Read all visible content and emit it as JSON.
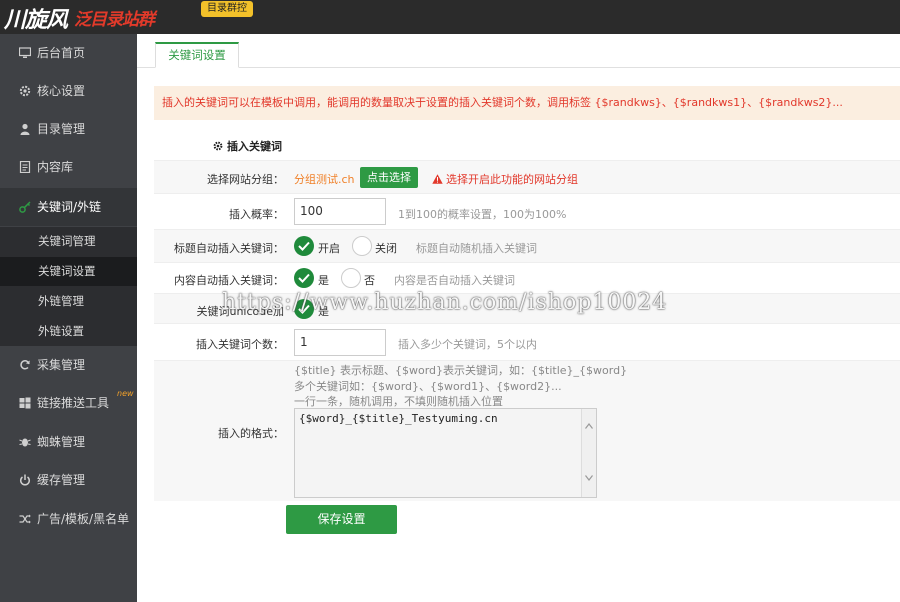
{
  "brand": {
    "logo": "川旋风",
    "subtitle": "泛目录站群",
    "badge": "目录群控"
  },
  "sidebar": {
    "items": [
      {
        "label": "后台首页",
        "icon": "monitor-icon"
      },
      {
        "label": "核心设置",
        "icon": "gear-icon"
      },
      {
        "label": "目录管理",
        "icon": "user-icon"
      },
      {
        "label": "内容库",
        "icon": "document-icon"
      },
      {
        "label": "关键词/外链",
        "icon": "key-icon"
      },
      {
        "label": "采集管理",
        "icon": "refresh-icon"
      },
      {
        "label": "链接推送工具",
        "icon": "windows-icon"
      },
      {
        "label": "蜘蛛管理",
        "icon": "bug-icon"
      },
      {
        "label": "缓存管理",
        "icon": "power-icon"
      },
      {
        "label": "广告/模板/黑名单",
        "icon": "shuffle-icon"
      }
    ],
    "subitems": [
      {
        "label": "关键词管理"
      },
      {
        "label": "关键词设置"
      },
      {
        "label": "外链管理"
      },
      {
        "label": "外链设置"
      }
    ],
    "new_badge": "new"
  },
  "tab": {
    "label": "关键词设置"
  },
  "notice": "插入的关键词可以在模板中调用，能调用的数量取决于设置的插入关键词个数，调用标签 {$randkws}、{$randkws1}、{$randkws2}...",
  "section_title": "插入关键词",
  "form": {
    "site_group": {
      "label": "选择网站分组：",
      "value": "分组测试.ch",
      "button": "点击选择",
      "warning": "选择开启此功能的网站分组"
    },
    "probability": {
      "label": "插入概率：",
      "value": "100",
      "hint": "1到100的概率设置，100为100%"
    },
    "title_auto": {
      "label": "标题自动插入关键词：",
      "on": "开启",
      "off": "关闭",
      "hint": "标题自动随机插入关键词"
    },
    "content_auto": {
      "label": "内容自动插入关键词：",
      "on": "是",
      "off": "否",
      "hint": "内容是否自动插入关键词"
    },
    "unicode": {
      "label": "关键词unicode加",
      "on": "是"
    },
    "count": {
      "label": "插入关键词个数：",
      "value": "1",
      "hint": "插入多少个关键词，5个以内"
    },
    "format": {
      "label": "插入的格式：",
      "help_lines": [
        "{$title} 表示标题、{$word}表示关键词，如：{$title}_{$word}",
        "多个关键词如：{$word}、{$word1}、{$word2}...",
        "一行一条，随机调用，不填则随机插入位置"
      ],
      "value": "{$word}_{$title}_Testyuming.cn"
    }
  },
  "save_button": "保存设置",
  "watermark": "https://www.huzhan.com/ishop10024",
  "colors": {
    "accent_green": "#2e9a44",
    "sidebar_bg": "#3f4145",
    "warning_red": "#e2382b",
    "orange": "#f08028",
    "badge_yellow": "#f3c12a"
  }
}
